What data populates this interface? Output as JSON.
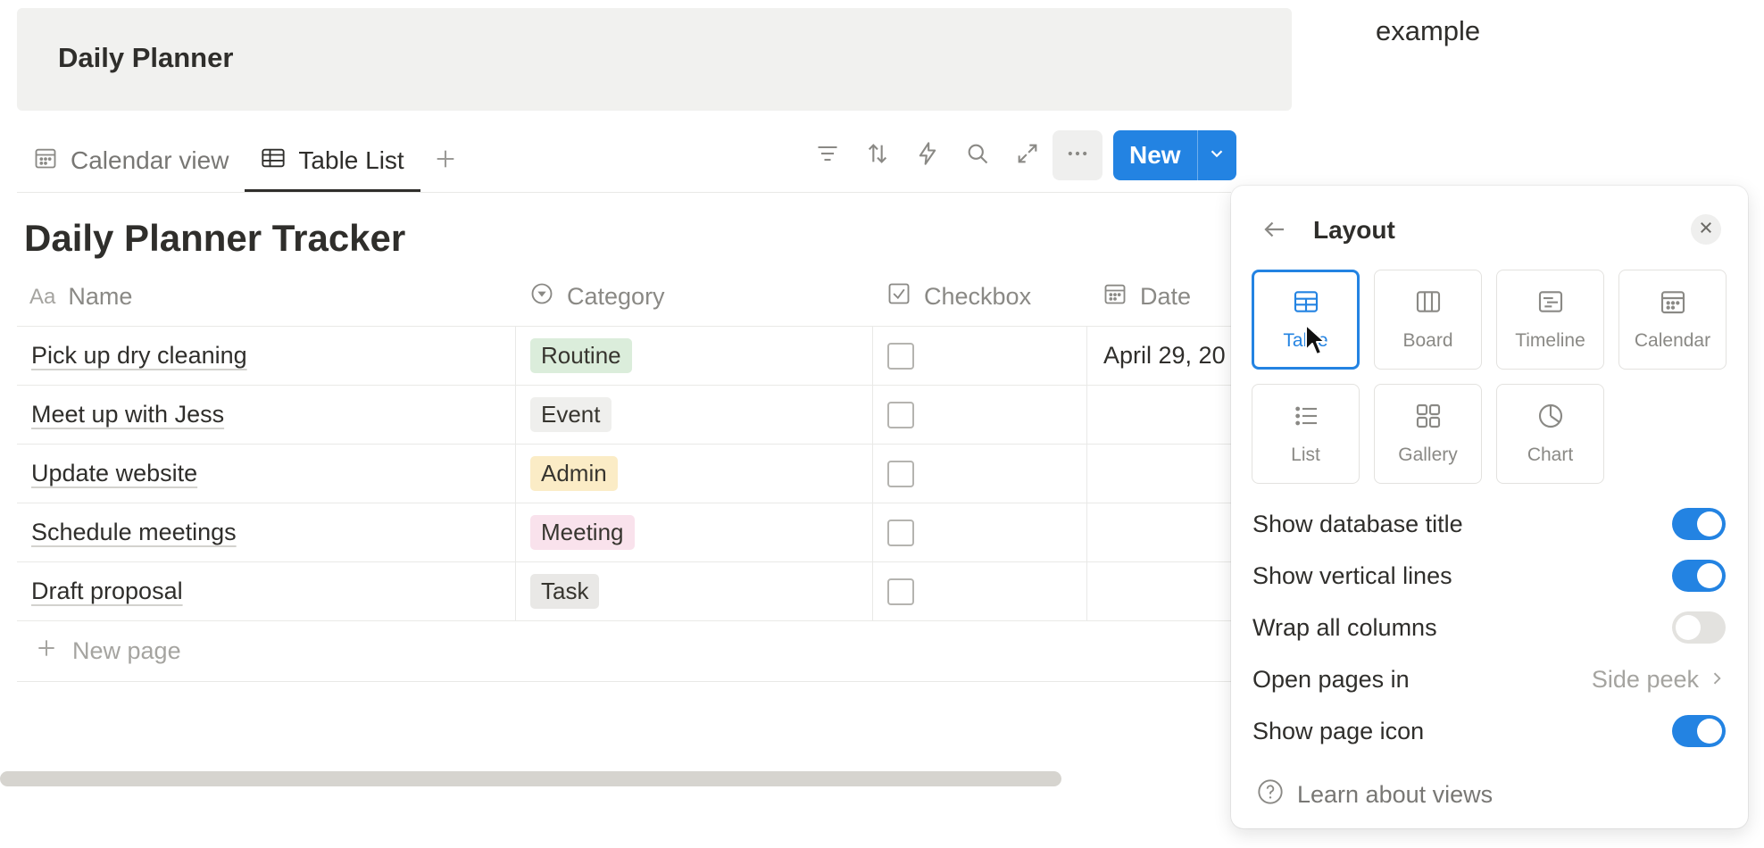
{
  "header": {
    "title": "Daily Planner"
  },
  "corner_label": "example",
  "tabs": [
    {
      "label": "Calendar view",
      "icon": "calendar-icon",
      "active": false
    },
    {
      "label": "Table List",
      "icon": "table-icon",
      "active": true
    }
  ],
  "toolbar": {
    "icons": [
      "filter-icon",
      "sort-icon",
      "automation-icon",
      "search-icon",
      "expand-icon",
      "more-icon"
    ],
    "new_label": "New"
  },
  "database": {
    "title": "Daily Planner Tracker",
    "columns": [
      {
        "label": "Name",
        "icon": "Aa"
      },
      {
        "label": "Category",
        "icon": "select-icon"
      },
      {
        "label": "Checkbox",
        "icon": "checkbox-icon"
      },
      {
        "label": "Date",
        "icon": "date-icon"
      }
    ],
    "rows": [
      {
        "name": "Pick up dry cleaning",
        "category": "Routine",
        "checked": false,
        "date": "April 29, 20"
      },
      {
        "name": "Meet up with Jess",
        "category": "Event",
        "checked": false,
        "date": ""
      },
      {
        "name": "Update website",
        "category": "Admin",
        "checked": false,
        "date": ""
      },
      {
        "name": "Schedule meetings",
        "category": "Meeting",
        "checked": false,
        "date": ""
      },
      {
        "name": "Draft proposal",
        "category": "Task",
        "checked": false,
        "date": ""
      }
    ],
    "new_page_label": "New page",
    "tag_colors": {
      "Routine": "#dbeddb",
      "Event": "#efefed",
      "Admin": "#fbecc6",
      "Meeting": "#f9e2ec",
      "Task": "#e9e8e6"
    }
  },
  "layout_panel": {
    "title": "Layout",
    "options": [
      {
        "label": "Table",
        "icon": "table-icon",
        "selected": true
      },
      {
        "label": "Board",
        "icon": "board-icon",
        "selected": false
      },
      {
        "label": "Timeline",
        "icon": "timeline-icon",
        "selected": false
      },
      {
        "label": "Calendar",
        "icon": "calendar-icon",
        "selected": false
      },
      {
        "label": "List",
        "icon": "list-icon",
        "selected": false
      },
      {
        "label": "Gallery",
        "icon": "gallery-icon",
        "selected": false
      },
      {
        "label": "Chart",
        "icon": "chart-icon",
        "selected": false
      }
    ],
    "settings": [
      {
        "label": "Show database title",
        "type": "toggle",
        "on": true
      },
      {
        "label": "Show vertical lines",
        "type": "toggle",
        "on": true
      },
      {
        "label": "Wrap all columns",
        "type": "toggle",
        "on": false
      },
      {
        "label": "Open pages in",
        "type": "value",
        "value": "Side peek"
      },
      {
        "label": "Show page icon",
        "type": "toggle",
        "on": true
      }
    ],
    "learn_label": "Learn about views"
  },
  "colors": {
    "accent": "#2383e2",
    "text": "#2f2e2b",
    "muted": "#8a8985"
  }
}
